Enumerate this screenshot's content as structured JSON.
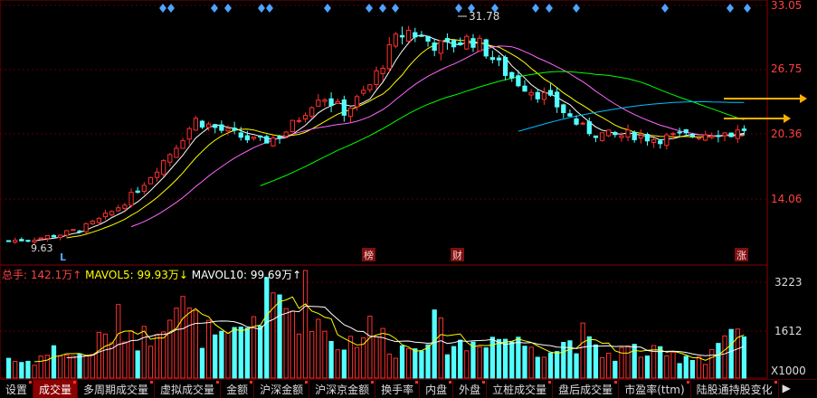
{
  "chart_data": [
    {
      "type": "candlestick",
      "title": "",
      "price_axis": {
        "ticks": [
          "33.05",
          "26.75",
          "20.36",
          "14.06"
        ],
        "ylim": [
          8.5,
          33.05
        ]
      },
      "annotations": {
        "high_label": "31.78",
        "low_label": "9.63",
        "events": [
          "榜",
          "财",
          "涨"
        ],
        "marker": "L"
      },
      "ma_colors": [
        "#ffffff",
        "#ffff00",
        "#ff66ff",
        "#00ff00",
        "#00bfff"
      ],
      "close_path": [
        9.9,
        10.0,
        10.1,
        10.3,
        10.5,
        10.8,
        11.2,
        11.8,
        12.5,
        13.4,
        14.5,
        15.8,
        17.2,
        18.6,
        20.2,
        21.8,
        21.3,
        20.8,
        20.4,
        20.0,
        19.6,
        19.9,
        20.4,
        21.6,
        23.0,
        24.4,
        23.4,
        22.6,
        23.8,
        25.2,
        27.4,
        29.6,
        30.6,
        30.0,
        29.3,
        28.9,
        29.4,
        29.8,
        29.0,
        27.6,
        26.3,
        25.4,
        24.7,
        24.1,
        23.2,
        22.1,
        21.0,
        20.5,
        20.3,
        20.2,
        20.4,
        20.1,
        19.9,
        20.1,
        20.2,
        20.3,
        20.5,
        20.6,
        20.4,
        20.9
      ]
    },
    {
      "type": "bar",
      "title": "",
      "legend": [
        {
          "label": "总手: 142.1万↑",
          "color": "#ff4040"
        },
        {
          "label": "MAVOL5: 99.93万↓",
          "color": "#ffff00"
        },
        {
          "label": "MAVOL10: 99.69万↑",
          "color": "#ffffff"
        }
      ],
      "volume_axis": {
        "ticks": [
          "3223",
          "1612"
        ],
        "unit": "X1000",
        "ylim": [
          0,
          3700
        ]
      },
      "volume_path": [
        800,
        600,
        700,
        900,
        1100,
        900,
        800,
        1300,
        1600,
        2200,
        1800,
        1500,
        2400,
        3200,
        2600,
        2000,
        1700,
        1300,
        1500,
        1900,
        2700,
        2900,
        3000,
        2500,
        3300,
        2000,
        1500,
        1300,
        1700,
        1900,
        1600,
        1200,
        1100,
        1700,
        2000,
        1500,
        1300,
        1200,
        1800,
        1500,
        1600,
        1300,
        1400,
        1200,
        1100,
        1500,
        1600,
        1000,
        900,
        1000,
        1100,
        1000,
        900,
        800,
        900,
        850,
        800,
        1500,
        1700,
        1200
      ]
    }
  ],
  "tabs": [
    "设置",
    "成交量",
    "多周期成交量",
    "虚拟成交量",
    "金额",
    "沪深金额",
    "沪深京金额",
    "换手率",
    "内盘",
    "外盘",
    "立桩成交量",
    "盘后成交量",
    "市盈率(ttm)",
    "陆股通持股变化"
  ],
  "active_tab": 1,
  "tab_next": "▶"
}
